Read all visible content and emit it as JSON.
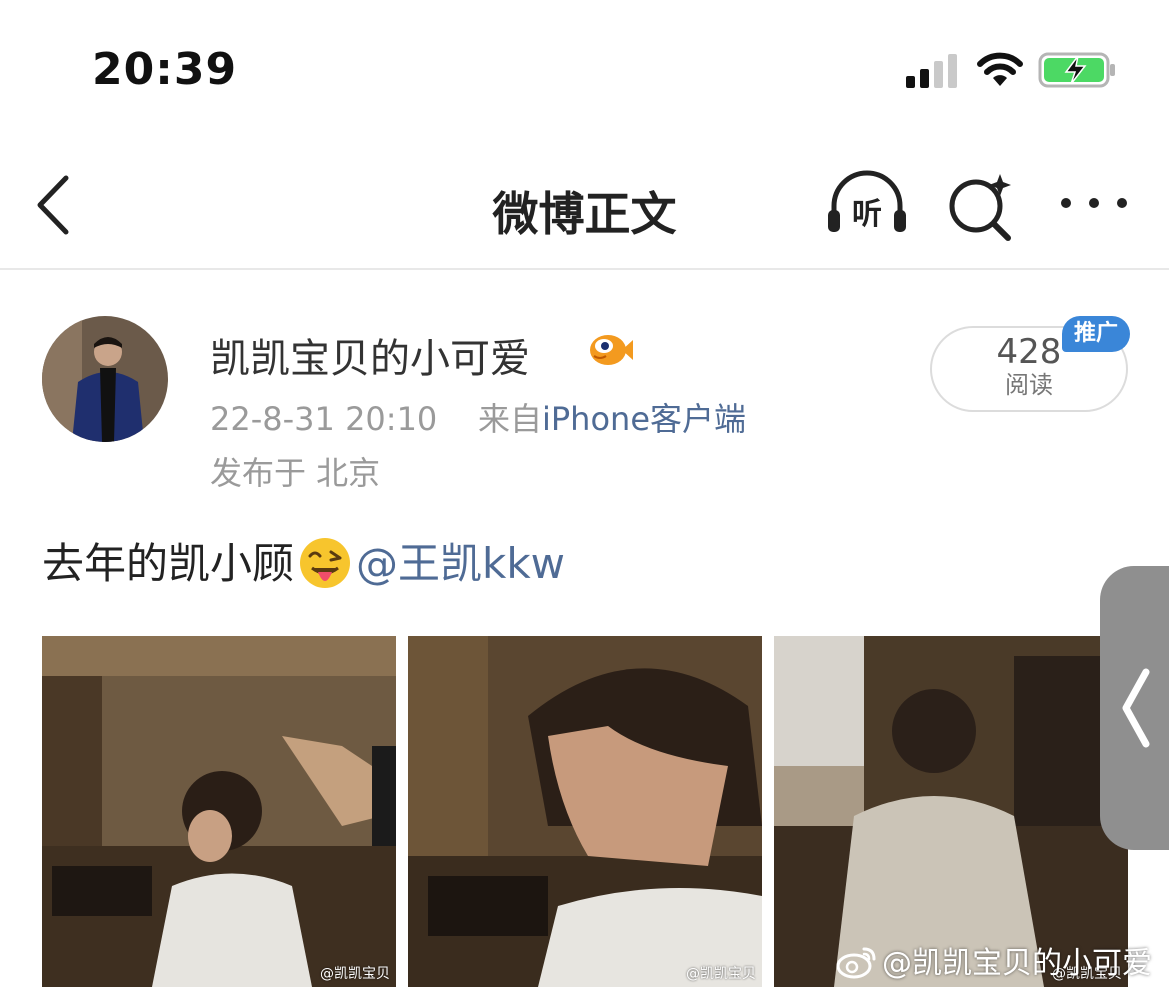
{
  "status_bar": {
    "time": "20:39",
    "icons": [
      "signal-icon",
      "wifi-icon",
      "battery-charging-icon"
    ]
  },
  "nav": {
    "title": "微博正文",
    "listen_label": "听",
    "icons": [
      "back-icon",
      "listen-icon",
      "search-icon",
      "more-icon"
    ]
  },
  "post": {
    "author": "凯凯宝贝的小可爱",
    "author_badge": "fish-emoji-badge",
    "time": "22-8-31 20:10",
    "source_prefix": "来自",
    "source_client": "iPhone客户端",
    "location": "发布于 北京",
    "read_count": "428",
    "read_label": "阅读",
    "promo_label": "推广",
    "text": "去年的凯小顾",
    "emoji": "tongue-out-face-emoji",
    "mention": "@王凯kkw"
  },
  "images": {
    "watermark_small": "@凯凯宝贝",
    "watermark_large": "@凯凯宝贝的小可爱"
  },
  "colors": {
    "link": "#4f6b95",
    "promo": "#3a86d8",
    "meta_gray": "#9a9a9a"
  }
}
